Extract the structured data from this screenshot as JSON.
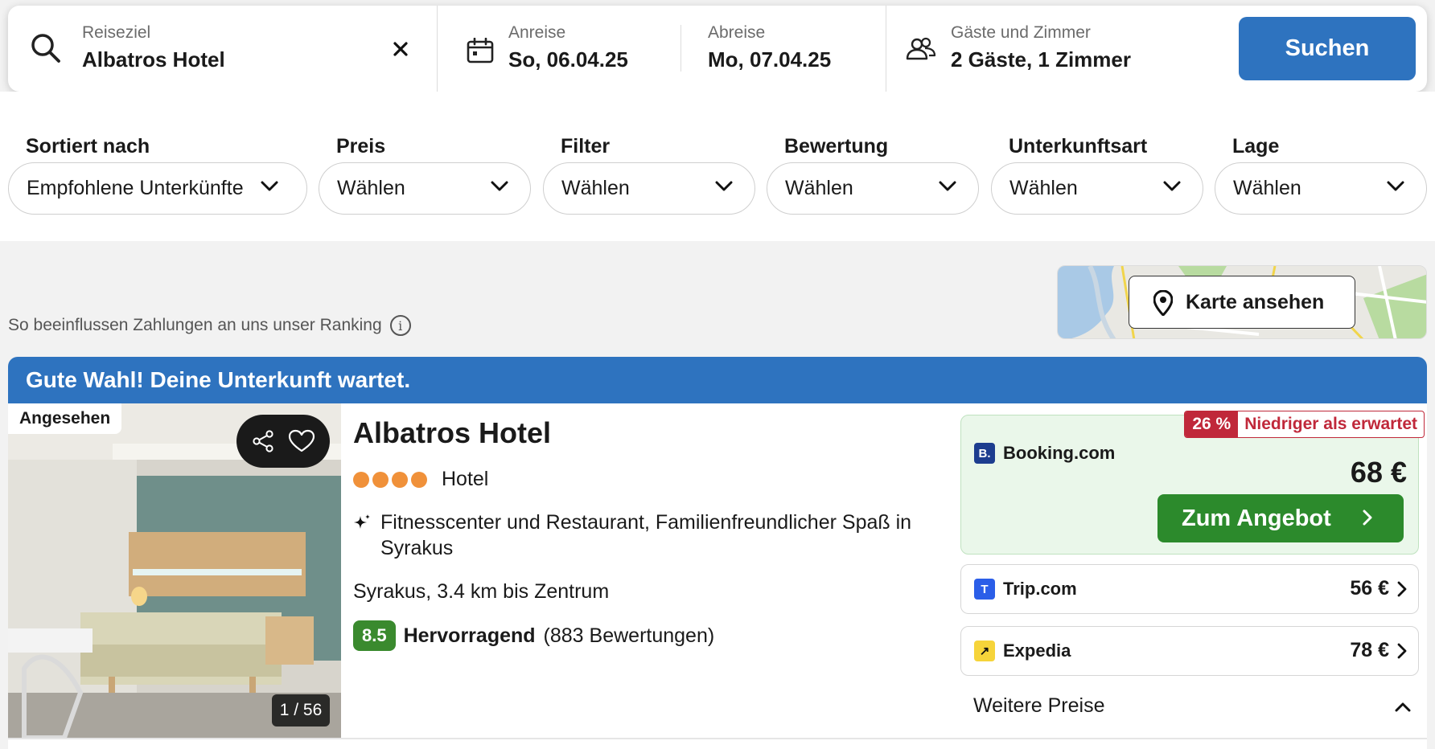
{
  "search": {
    "destination_label": "Reiseziel",
    "destination_value": "Albatros Hotel",
    "checkin_label": "Anreise",
    "checkin_value": "So, 06.04.25",
    "checkout_label": "Abreise",
    "checkout_value": "Mo, 07.04.25",
    "guests_label": "Gäste und Zimmer",
    "guests_value": "2 Gäste, 1 Zimmer",
    "search_button": "Suchen"
  },
  "filters": [
    {
      "title": "Sortiert nach",
      "value": "Empfohlene Unterkünfte"
    },
    {
      "title": "Preis",
      "value": "Wählen"
    },
    {
      "title": "Filter",
      "value": "Wählen"
    },
    {
      "title": "Bewertung",
      "value": "Wählen"
    },
    {
      "title": "Unterkunftsart",
      "value": "Wählen"
    },
    {
      "title": "Lage",
      "value": "Wählen"
    }
  ],
  "ranking_note": "So beeinflussen Zahlungen an uns unser Ranking",
  "map_button": "Karte ansehen",
  "banner": "Gute Wahl! Deine Unterkunft wartet.",
  "hotel": {
    "seen_badge": "Angesehen",
    "photo_counter": "1 / 56",
    "name": "Albatros Hotel",
    "stars": 4,
    "type": "Hotel",
    "feature": "Fitnesscenter und Restaurant, Familienfreundlicher Spaß in Syrakus",
    "location": "Syrakus, 3.4 km bis Zentrum",
    "rating_score": "8.5",
    "rating_word": "Hervorragend",
    "rating_count": "(883 Bewertungen)"
  },
  "offers": {
    "main": {
      "provider": "Booking.com",
      "logo": "B.",
      "discount_pct": "26 %",
      "discount_text": "Niedriger als erwartet",
      "price": "68 €",
      "button": "Zum Angebot"
    },
    "others": [
      {
        "provider": "Trip.com",
        "logo": "T",
        "price": "56 €"
      },
      {
        "provider": "Expedia",
        "logo": "↗",
        "price": "78 €"
      }
    ],
    "more_prices": "Weitere Preise"
  },
  "colors": {
    "primary": "#2e73bf",
    "offer_green": "#2c8a2c",
    "rating_green": "#3a8a2e",
    "discount_red": "#c0283a",
    "star_orange": "#f0913a"
  }
}
